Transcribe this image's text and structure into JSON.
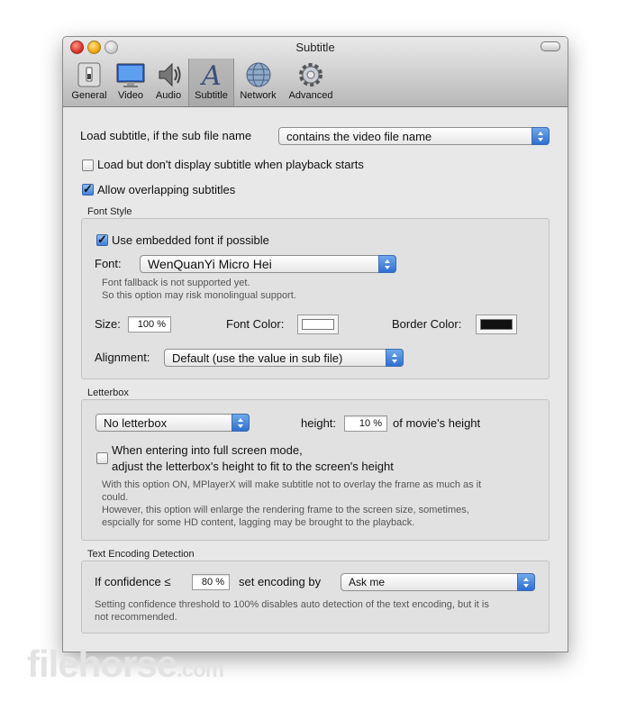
{
  "window": {
    "title": "Subtitle"
  },
  "toolbar": {
    "items": [
      {
        "label": "General",
        "icon": "switch-icon"
      },
      {
        "label": "Video",
        "icon": "monitor-icon"
      },
      {
        "label": "Audio",
        "icon": "speaker-icon"
      },
      {
        "label": "Subtitle",
        "icon": "letter-a-icon",
        "selected": true
      },
      {
        "label": "Network",
        "icon": "globe-icon"
      },
      {
        "label": "Advanced",
        "icon": "gear-icon"
      }
    ]
  },
  "load_subtitle": {
    "label": "Load subtitle, if the sub file name",
    "selected": "contains the video file name"
  },
  "load_no_display": {
    "label": "Load but don't display subtitle when playback starts",
    "checked": false
  },
  "allow_overlap": {
    "label": "Allow overlapping subtitles",
    "checked": true
  },
  "font_style": {
    "heading": "Font Style",
    "use_embedded": {
      "label": "Use embedded font if possible",
      "checked": true
    },
    "font_label": "Font:",
    "font_value": "WenQuanYi Micro Hei",
    "note_line1": "Font fallback is not supported yet.",
    "note_line2": "So this option may risk monolingual support.",
    "size_label": "Size:",
    "size_value": "100 %",
    "font_color_label": "Font Color:",
    "font_color": "#ffffff",
    "border_color_label": "Border Color:",
    "border_color": "#111111",
    "alignment_label": "Alignment:",
    "alignment_value": "Default (use the value in sub file)"
  },
  "letterbox": {
    "heading": "Letterbox",
    "mode_value": "No letterbox",
    "height_label": "height:",
    "height_value": "10 %",
    "height_suffix": "of movie's height",
    "fullscreen_line1": "When entering into full screen mode,",
    "fullscreen_line2": "adjust the letterbox's height to fit to the screen's height",
    "fullscreen_checked": false,
    "note1_line1": "With this option ON, MPlayerX will make subtitle not to overlay the frame as much as it",
    "note1_line2": "could.",
    "note2_line1": "However, this option will enlarge the rendering frame to the screen size, sometimes,",
    "note2_line2": "espcially for some HD content, lagging may be brought to the playback."
  },
  "encoding": {
    "heading": "Text Encoding Detection",
    "confidence_label": "If confidence ≤",
    "confidence_value": "80 %",
    "set_label": "set encoding by",
    "set_value": "Ask me",
    "note_line1": "Setting confidence threshold to 100% disables auto detection of the text encoding, but it is",
    "note_line2": "not recommended."
  },
  "watermark": {
    "main": "filehorse",
    "suffix": ".com"
  },
  "colors": {
    "accent": "#3f7fd9",
    "window_bg": "#e8e8e8"
  }
}
